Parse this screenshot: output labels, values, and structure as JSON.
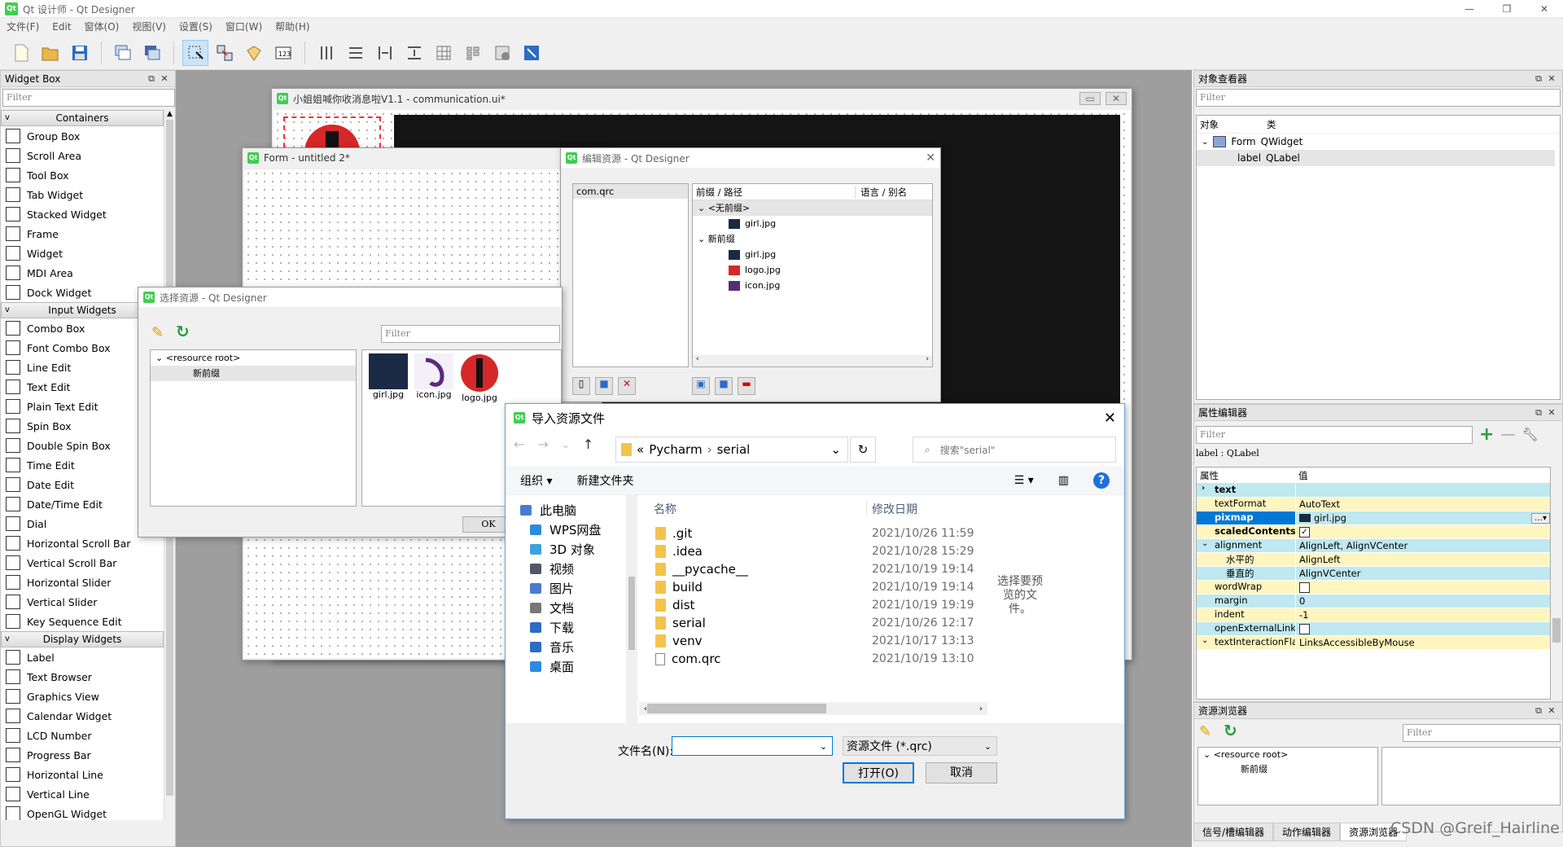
{
  "titlebar": {
    "title": "Qt 设计师 - Qt Designer",
    "app_icon_text": "Qt"
  },
  "menu": [
    "文件(F)",
    "Edit",
    "窗体(O)",
    "视图(V)",
    "设置(S)",
    "窗口(W)",
    "帮助(H)"
  ],
  "widget_box": {
    "title": "Widget Box",
    "filter_placeholder": "Filter",
    "categories": {
      "containers": "Containers",
      "input": "Input Widgets",
      "display": "Display Widgets"
    },
    "containers": [
      "Group Box",
      "Scroll Area",
      "Tool Box",
      "Tab Widget",
      "Stacked Widget",
      "Frame",
      "Widget",
      "MDI Area",
      "Dock Widget"
    ],
    "inputs": [
      "Combo Box",
      "Font Combo Box",
      "Line Edit",
      "Text Edit",
      "Plain Text Edit",
      "Spin Box",
      "Double Spin Box",
      "Time Edit",
      "Date Edit",
      "Date/Time Edit",
      "Dial",
      "Horizontal Scroll Bar",
      "Vertical Scroll Bar",
      "Horizontal Slider",
      "Vertical Slider",
      "Key Sequence Edit"
    ],
    "display": [
      "Label",
      "Text Browser",
      "Graphics View",
      "Calendar Widget",
      "LCD Number",
      "Progress Bar",
      "Horizontal Line",
      "Vertical Line",
      "OpenGL Widget"
    ]
  },
  "main_form": {
    "title": "小姐姐喊你收消息啦V1.1 - communication.ui*"
  },
  "form_untitled": {
    "title": "Form - untitled 2*"
  },
  "edit_resource": {
    "title": "编辑资源 - Qt Designer",
    "qrc_file": "com.qrc",
    "col_prefix": "前缀 / 路径",
    "col_lang": "语言 / 别名",
    "no_prefix": "<无前缀>",
    "new_prefix": "新前缀",
    "files_a": [
      "girl.jpg"
    ],
    "files_b": [
      "girl.jpg",
      "logo.jpg",
      "icon.jpg"
    ]
  },
  "select_resource": {
    "title": "选择资源 - Qt Designer",
    "filter_placeholder": "Filter",
    "root": "<resource root>",
    "child": "新前缀",
    "images": [
      "girl.jpg",
      "icon.jpg",
      "logo.jpg"
    ],
    "ok": "OK"
  },
  "import_dialog": {
    "title": "导入资源文件",
    "path": [
      "«",
      "Pycharm",
      "›",
      "serial"
    ],
    "search_placeholder": "搜索\"serial\"",
    "organize": "组织 ▾",
    "new_folder": "新建文件夹",
    "nav": [
      "此电脑",
      "WPS网盘",
      "3D 对象",
      "视频",
      "图片",
      "文档",
      "下载",
      "音乐",
      "桌面"
    ],
    "col_name": "名称",
    "col_date": "修改日期",
    "files": [
      {
        "name": ".git",
        "date": "2021/10/26 11:59",
        "type": "folder"
      },
      {
        "name": ".idea",
        "date": "2021/10/28 15:29",
        "type": "folder"
      },
      {
        "name": "__pycache__",
        "date": "2021/10/19 19:14",
        "type": "folder"
      },
      {
        "name": "build",
        "date": "2021/10/19 19:14",
        "type": "folder"
      },
      {
        "name": "dist",
        "date": "2021/10/19 19:19",
        "type": "folder"
      },
      {
        "name": "serial",
        "date": "2021/10/26 12:17",
        "type": "folder"
      },
      {
        "name": "venv",
        "date": "2021/10/17 13:13",
        "type": "folder"
      },
      {
        "name": "com.qrc",
        "date": "2021/10/19 13:10",
        "type": "file"
      }
    ],
    "preview_hint": "选择要预览的文件。",
    "filename_label": "文件名(N):",
    "filename_value": "",
    "filetype": "资源文件 (*.qrc)",
    "open": "打开(O)",
    "cancel": "取消"
  },
  "object_inspector": {
    "title": "对象查看器",
    "filter_placeholder": "Filter",
    "col_object": "对象",
    "col_class": "类",
    "rows": [
      {
        "name": "Form",
        "cls": "QWidget"
      },
      {
        "name": "label",
        "cls": "QLabel"
      }
    ]
  },
  "property_editor": {
    "title": "属性编辑器",
    "filter_placeholder": "Filter",
    "context": "label : QLabel",
    "col_prop": "属性",
    "col_value": "值",
    "rows": [
      {
        "k": "text",
        "v": "",
        "style": "b",
        "exp": "›"
      },
      {
        "k": "textFormat",
        "v": "AutoText",
        "style": ""
      },
      {
        "k": "pixmap",
        "v": "girl.jpg",
        "style": "sel"
      },
      {
        "k": "scaledContents",
        "v": "",
        "style": "b",
        "check": true
      },
      {
        "k": "alignment",
        "v": "AlignLeft, AlignVCenter",
        "style": "",
        "exp": "v"
      },
      {
        "k": "水平的",
        "v": "AlignLeft",
        "style": "",
        "indent": true
      },
      {
        "k": "垂直的",
        "v": "AlignVCenter",
        "style": "",
        "indent": true
      },
      {
        "k": "wordWrap",
        "v": "",
        "style": "",
        "check": false
      },
      {
        "k": "margin",
        "v": "0",
        "style": ""
      },
      {
        "k": "indent",
        "v": "-1",
        "style": ""
      },
      {
        "k": "openExternalLinks",
        "v": "",
        "style": "",
        "check": false
      },
      {
        "k": "textInteractionFlags",
        "v": "LinksAccessibleByMouse",
        "style": "",
        "exp": "v"
      }
    ]
  },
  "resource_browser": {
    "title": "资源浏览器",
    "filter_placeholder": "Filter",
    "root": "<resource root>",
    "child": "新前缀"
  },
  "bottom_tabs": [
    "信号/槽编辑器",
    "动作编辑器",
    "资源浏览器"
  ],
  "watermark": "CSDN @Greif_Hairline",
  "colors": {
    "qt_green": "#41cd52",
    "selection": "#0078d7",
    "prop_cyan": "#bfe8f0",
    "prop_yellow": "#fff5bf",
    "workspace": "#9e9e9e"
  }
}
